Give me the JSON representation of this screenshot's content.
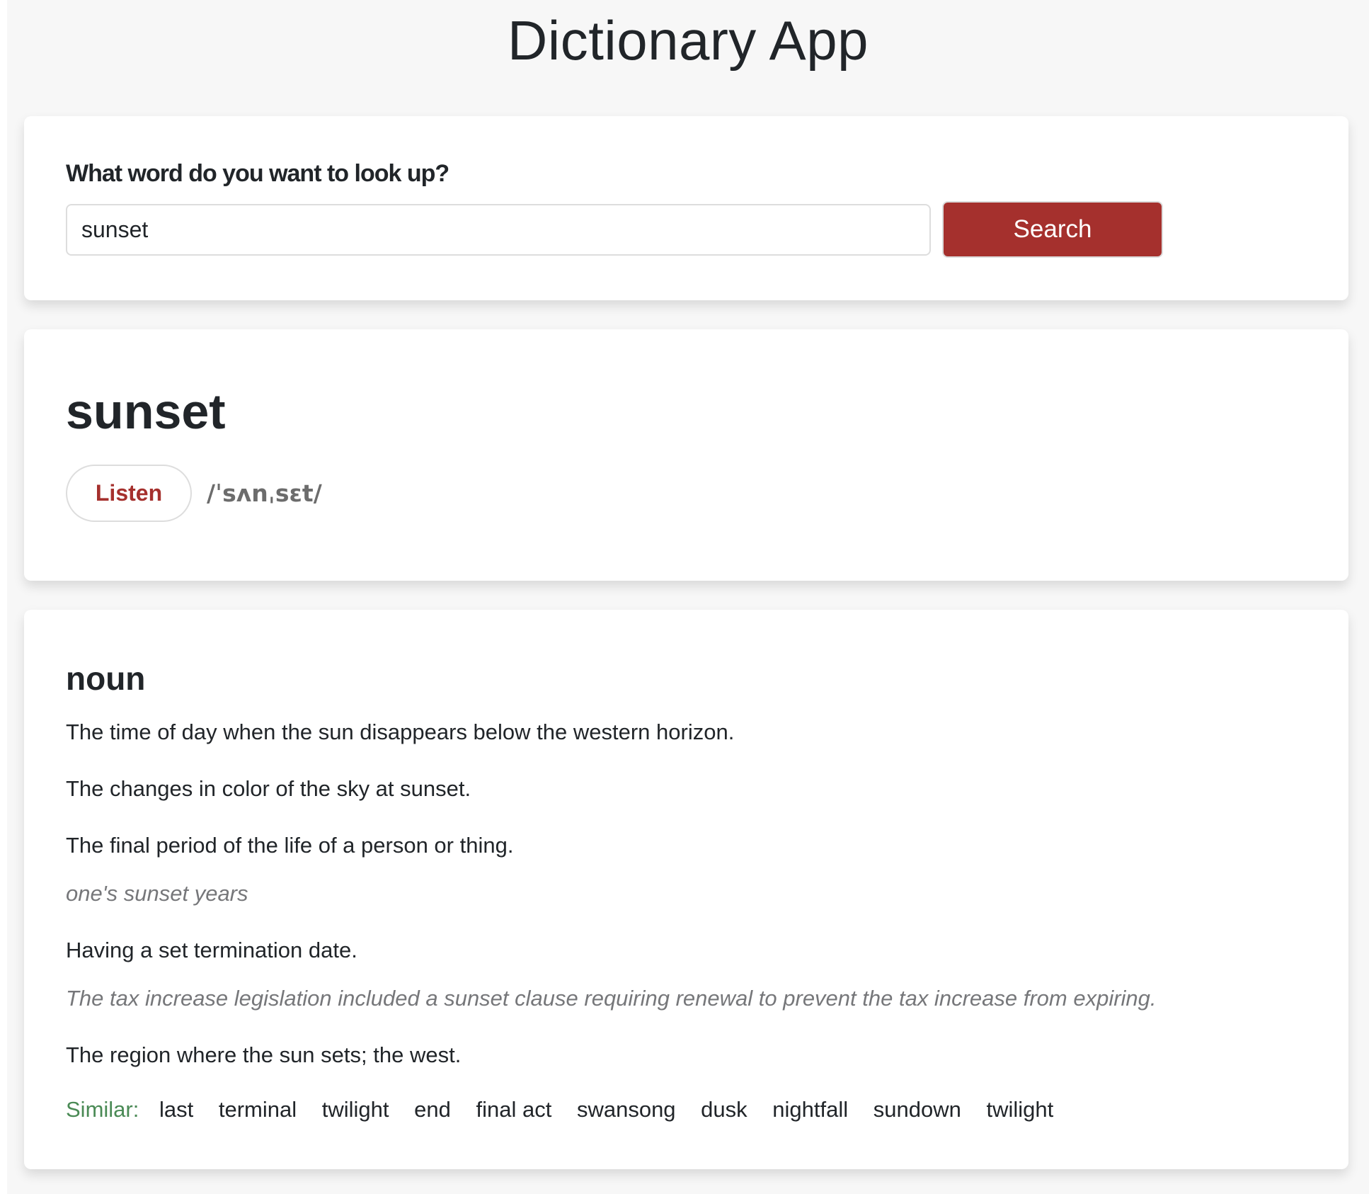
{
  "app": {
    "title": "Dictionary App"
  },
  "search": {
    "label": "What word do you want to look up?",
    "value": "sunset",
    "button_label": "Search"
  },
  "word": {
    "headword": "sunset",
    "listen_label": "Listen",
    "phonetic": "/ˈsʌnˌsɛt/"
  },
  "meaning": {
    "part_of_speech": "noun",
    "entries": [
      {
        "type": "definition",
        "text": "The time of day when the sun disappears below the western horizon."
      },
      {
        "type": "definition",
        "text": "The changes in color of the sky at sunset."
      },
      {
        "type": "definition",
        "text": "The final period of the life of a person or thing."
      },
      {
        "type": "example",
        "text": "one's sunset years"
      },
      {
        "type": "definition",
        "text": "Having a set termination date."
      },
      {
        "type": "example",
        "text": "The tax increase legislation included a sunset clause requiring renewal to prevent the tax increase from expiring."
      },
      {
        "type": "definition",
        "text": "The region where the sun sets; the west."
      }
    ],
    "similar_label": "Similar:",
    "similar": [
      "last",
      "terminal",
      "twilight",
      "end",
      "final act",
      "swansong",
      "dusk",
      "nightfall",
      "sundown",
      "twilight"
    ]
  },
  "colors": {
    "accent": "#a5302d",
    "similar_label": "#4a8a55",
    "example_text": "#76777a"
  }
}
